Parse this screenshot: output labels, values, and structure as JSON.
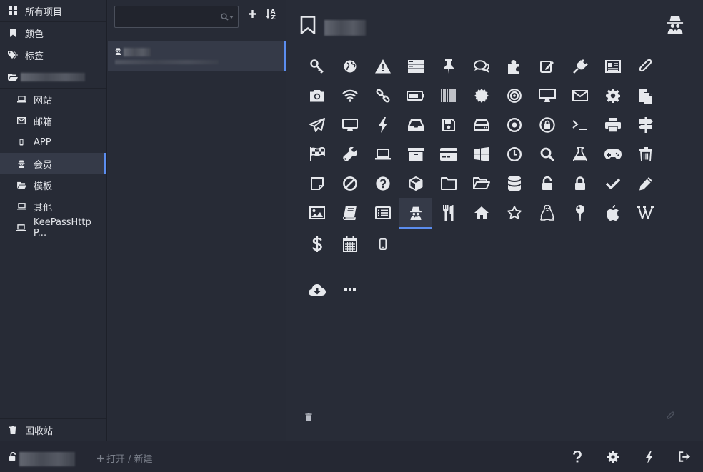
{
  "sidebar": {
    "top_items": [
      {
        "label": "所有项目",
        "icon": "grid-icon"
      },
      {
        "label": "颜色",
        "icon": "bookmark-icon"
      },
      {
        "label": "标签",
        "icon": "tags-icon"
      }
    ],
    "groups": [
      {
        "label": "网站",
        "icon": "laptop-icon"
      },
      {
        "label": "邮箱",
        "icon": "envelope-icon"
      },
      {
        "label": "APP",
        "icon": "mobile-icon"
      },
      {
        "label": "会员",
        "icon": "user-secret-icon",
        "active": true
      },
      {
        "label": "模板",
        "icon": "folder-open-icon"
      },
      {
        "label": "其他",
        "icon": "laptop-icon"
      },
      {
        "label": "KeePassHttp P...",
        "icon": "laptop-icon"
      }
    ],
    "trash_label": "回收站"
  },
  "footer": {
    "open_label": "打开 / 新建"
  },
  "colors": {
    "accent": "#5b8def",
    "background": "#282c37",
    "active_row": "#353a48"
  }
}
